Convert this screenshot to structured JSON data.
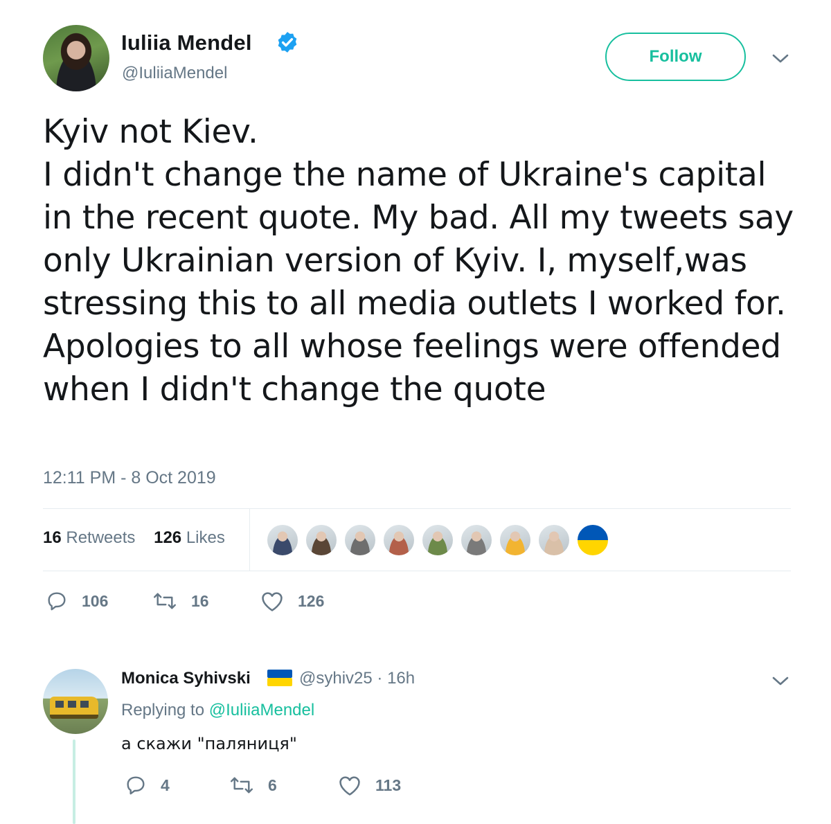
{
  "author": {
    "name": "Iuliia Mendel",
    "handle": "@IuliiaMendel",
    "verified": true
  },
  "follow_label": "Follow",
  "tweet": {
    "text": "Kyiv not Kiev.\nI didn't change the name of Ukraine's capital in the recent quote. My bad. All my tweets say only Ukrainian version of Kyiv. I, myself,was stressing this to all media outlets I worked for. Apologies to all whose feelings were offended when I didn't change the quote",
    "timestamp": "12:11 PM - 8 Oct 2019"
  },
  "stats": {
    "retweets_count": "16",
    "retweets_label": "Retweets",
    "likes_count": "126",
    "likes_label": "Likes"
  },
  "likers": [
    {
      "name": "liker-1",
      "color": "#3b4a6b"
    },
    {
      "name": "liker-2",
      "color": "#5a4636"
    },
    {
      "name": "liker-3",
      "color": "#6e6e6e"
    },
    {
      "name": "liker-4",
      "color": "#b3604a"
    },
    {
      "name": "liker-5",
      "color": "#6d8a4a"
    },
    {
      "name": "liker-6",
      "color": "#7a7a7a"
    },
    {
      "name": "liker-7",
      "color": "#f2b431"
    },
    {
      "name": "liker-8",
      "color": "#d9c0a8"
    },
    {
      "name": "liker-9",
      "color": "#ffd500"
    }
  ],
  "actions": {
    "replies": "106",
    "retweets": "16",
    "likes": "126"
  },
  "reply": {
    "name": "Monica Syhivski",
    "handle_time": "@syhiv25 · 16h",
    "replying_prefix": "Replying to",
    "replying_to": "@IuliiaMendel",
    "text": "а скажи \"паляниця\"",
    "actions": {
      "replies": "4",
      "retweets": "6",
      "likes": "113"
    }
  },
  "colors": {
    "accent": "#17bf9e",
    "muted": "#657786",
    "text": "#14171a",
    "verified": "#1da1f2"
  }
}
